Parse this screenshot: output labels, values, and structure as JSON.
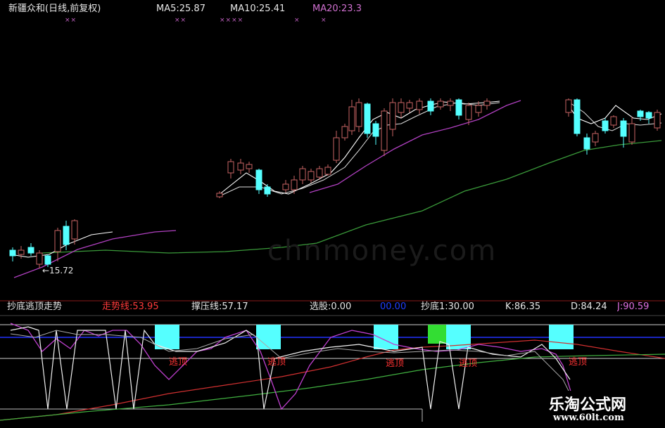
{
  "header": {
    "title": "新疆众和(日线,前复权)",
    "ma5": "MA5:25.87",
    "ma10": "MA10:25.41",
    "ma20": "MA20:23.3"
  },
  "header_marks": [
    "××",
    "××",
    "××××",
    "×",
    "×"
  ],
  "price_annotation": "←15.72",
  "indicator": {
    "name": "抄底逃顶走势",
    "trend_line": "走势线:53.95",
    "support_line": "撑压线:57.17",
    "stock_pick": "选股:0.00",
    "hidden_value": "00.00",
    "bottom": "抄底1:30.00",
    "k": "K:86.35",
    "d": "D:84.24",
    "j": "J:90.59"
  },
  "signal_labels": [
    "逃顶",
    "逃顶",
    "逃顶",
    "逃顶",
    "逃顶"
  ],
  "watermark": "chnmoney.com",
  "brand": {
    "name": "乐淘公式网",
    "url": "www.60lt.com"
  },
  "colors": {
    "background": "#000000",
    "up_candle": "#c86464",
    "down_candle": "#55ffff",
    "ma5": "#ffffff",
    "ma10": "#dddddd",
    "ma20": "#b040c0",
    "ma60": "#40a040",
    "signal_box": "#55ffff",
    "signal_box_green": "#33dd33"
  }
}
